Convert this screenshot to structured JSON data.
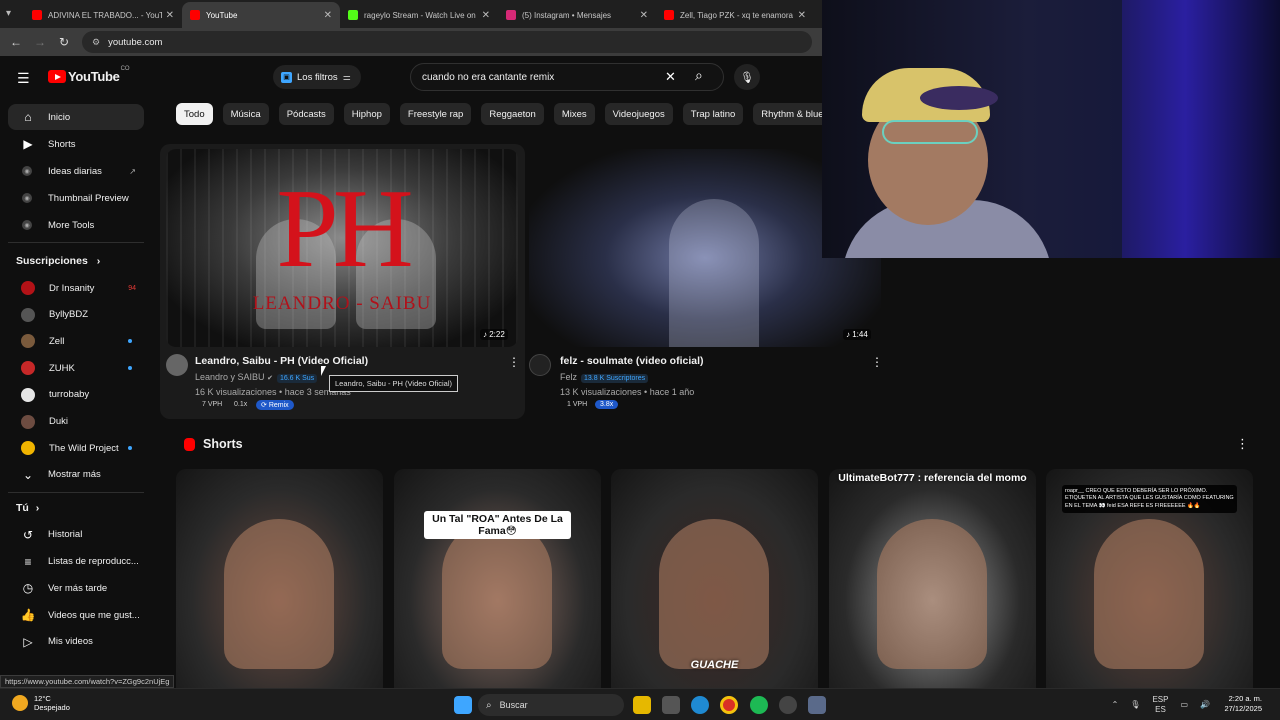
{
  "browser": {
    "tabs": [
      {
        "title": "ADIVINA EL TRABADO... - YouTube",
        "color": "#ff0000",
        "active": false
      },
      {
        "title": "YouTube",
        "color": "#ff0000",
        "active": true
      },
      {
        "title": "rageylo Stream - Watch Live on",
        "color": "#53fc18",
        "active": false
      },
      {
        "title": "(5) Instagram • Mensajes",
        "color": "#d62976",
        "active": false
      },
      {
        "title": "Zell, Tiago PZK - xq te enamora",
        "color": "#ff0000",
        "active": false
      }
    ],
    "url": "youtube.com"
  },
  "youtube": {
    "logo_text": "YouTube",
    "country_code": "CO",
    "filters_label": "Los filtros",
    "search_value": "cuando no era cantante remix",
    "chips": [
      "Todo",
      "Música",
      "Pódcasts",
      "Hiphop",
      "Freestyle rap",
      "Reggaeton",
      "Mixes",
      "Videojuegos",
      "Trap latino",
      "Rhythm & blues"
    ],
    "sidebar": {
      "main": [
        {
          "label": "Inicio",
          "icon": "home-icon",
          "glyph": "⌂"
        },
        {
          "label": "Shorts",
          "icon": "shorts-icon",
          "glyph": "▶"
        }
      ],
      "extras": [
        {
          "label": "Ideas diarias",
          "ext": "↗"
        },
        {
          "label": "Thumbnail Preview",
          "ext": ""
        },
        {
          "label": "More Tools",
          "ext": ""
        }
      ],
      "subs_title": "Suscripciones",
      "subs": [
        {
          "label": "Dr Insanity",
          "color": "#b31217",
          "badge": "94"
        },
        {
          "label": "ByllyBDZ",
          "color": "#555",
          "badge": ""
        },
        {
          "label": "Zell",
          "color": "#7a5a3c",
          "badge": "dot"
        },
        {
          "label": "ZUHK",
          "color": "#c62828",
          "badge": "dot"
        },
        {
          "label": "turrobaby",
          "color": "#e6e6e6",
          "badge": ""
        },
        {
          "label": "Duki",
          "color": "#6d4c41",
          "badge": ""
        },
        {
          "label": "The Wild Project",
          "color": "#f0b400",
          "badge": "dot"
        }
      ],
      "show_more": "Mostrar más",
      "you_title": "Tú",
      "you": [
        {
          "label": "Historial",
          "glyph": "↺"
        },
        {
          "label": "Listas de reproducc...",
          "glyph": "≡"
        },
        {
          "label": "Ver más tarde",
          "glyph": "◷"
        },
        {
          "label": "Videos que me gust...",
          "glyph": "👍"
        },
        {
          "label": "Mis videos",
          "glyph": "▷"
        }
      ]
    },
    "videos": [
      {
        "title": "Leandro, Saibu - PH (Video Oficial)",
        "channel": "Leandro y SAIBU",
        "subs": "16.6 K Sus",
        "stats": "16 K visualizaciones • hace 3 semanas",
        "vph": "7 VPH",
        "ratio": "0.1x",
        "tag": "Remix",
        "duration": "2:22",
        "thumb_text": "PH",
        "thumb_caption": "LEANDRO - SAIBU"
      },
      {
        "title": "felz - soulmate (video oficial)",
        "channel": "Felz",
        "subs": "13.8 K Suscriptores",
        "stats": "13 K visualizaciones • hace 1 año",
        "vph": "1 VPH",
        "ratio": "3.8x",
        "duration": "1:44"
      }
    ],
    "tooltip": "Leandro, Saibu - PH (Video Oficial)",
    "shorts_title": "Shorts",
    "shorts": [
      {
        "overlay": "",
        "bg": "#6d4c41"
      },
      {
        "overlay": "Un Tal \"ROA\" Antes De La Fama😳",
        "bg": "#8d6e63"
      },
      {
        "overlay": "GUACHE",
        "bg": "#3e2723"
      },
      {
        "overlay": "UltimateBot777 : referencia del momo",
        "bg": "#9e9e9e"
      },
      {
        "overlay": "roapr__ CREO QUE ESTO DEBERÍA SER LO PRÓXIMO. ETIQUETEN AL ARTISTA QUE LES GUSTARÍA COMO FEATURING EN EL TEMA 👀 feid ESA REFE ES FIREEEEEE 🔥🔥",
        "bg": "#5d4037"
      }
    ]
  },
  "status_url": "https://www.youtube.com/watch?v=ZGg9c2nUjEg",
  "taskbar": {
    "temp": "12°C",
    "weather": "Despejado",
    "search": "Buscar",
    "lang": "ESP",
    "region": "ES",
    "time": "2:20 a. m.",
    "date": "27/12/2025"
  }
}
